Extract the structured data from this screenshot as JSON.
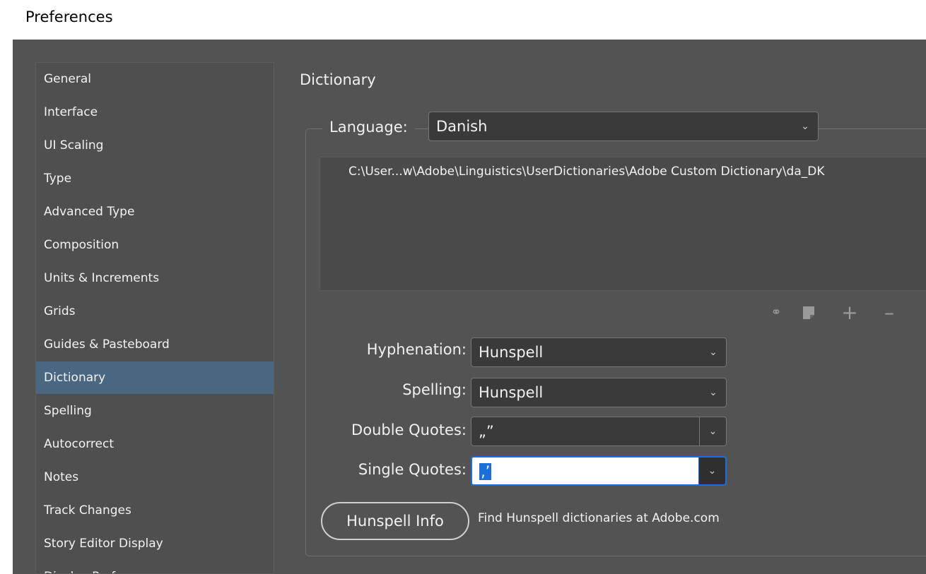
{
  "window": {
    "title": "Preferences"
  },
  "sidebar": {
    "items": [
      {
        "label": "General"
      },
      {
        "label": "Interface"
      },
      {
        "label": "UI Scaling"
      },
      {
        "label": "Type"
      },
      {
        "label": "Advanced Type"
      },
      {
        "label": "Composition"
      },
      {
        "label": "Units & Increments"
      },
      {
        "label": "Grids"
      },
      {
        "label": "Guides & Pasteboard"
      },
      {
        "label": "Dictionary",
        "active": true
      },
      {
        "label": "Spelling"
      },
      {
        "label": "Autocorrect"
      },
      {
        "label": "Notes"
      },
      {
        "label": "Track Changes"
      },
      {
        "label": "Story Editor Display"
      },
      {
        "label": "Display Performance"
      }
    ]
  },
  "main": {
    "section_title": "Dictionary",
    "language": {
      "label": "Language:",
      "value": "Danish"
    },
    "dictionary_list": {
      "rows": [
        "C:\\User...w\\Adobe\\Linguistics\\UserDictionaries\\Adobe Custom Dictionary\\da_DK"
      ]
    },
    "list_actions": {
      "icons": [
        "link-icon",
        "new-page-icon",
        "plus-icon",
        "minus-icon"
      ]
    },
    "hyphenation": {
      "label": "Hyphenation:",
      "value": "Hunspell"
    },
    "spelling": {
      "label": "Spelling:",
      "value": "Hunspell"
    },
    "double_quotes": {
      "label": "Double Quotes:",
      "value": "„”"
    },
    "single_quotes": {
      "label": "Single Quotes:",
      "value": "‚’"
    },
    "hunspell_info": {
      "button_label": "Hunspell Info",
      "description": "Find Hunspell dictionaries at Adobe.com"
    }
  },
  "colors": {
    "dialog_bg": "#535353",
    "sidebar_active": "#4a6781",
    "focus_accent": "#1a6fd8"
  }
}
